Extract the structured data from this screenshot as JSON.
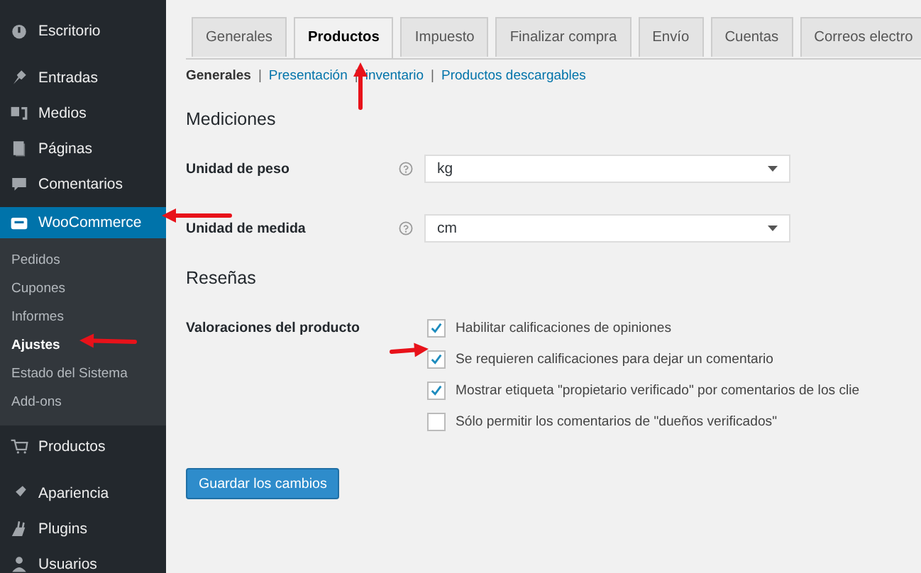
{
  "sidebar": {
    "items": [
      {
        "label": "Escritorio",
        "selected": false
      },
      {
        "label": "Entradas",
        "selected": false
      },
      {
        "label": "Medios",
        "selected": false
      },
      {
        "label": "Páginas",
        "selected": false
      },
      {
        "label": "Comentarios",
        "selected": false
      },
      {
        "label": "WooCommerce",
        "selected": true,
        "children": [
          {
            "label": "Pedidos",
            "selected": false
          },
          {
            "label": "Cupones",
            "selected": false
          },
          {
            "label": "Informes",
            "selected": false
          },
          {
            "label": "Ajustes",
            "selected": true
          },
          {
            "label": "Estado del Sistema",
            "selected": false
          },
          {
            "label": "Add-ons",
            "selected": false
          }
        ]
      },
      {
        "label": "Productos",
        "selected": false
      },
      {
        "label": "Apariencia",
        "selected": false
      },
      {
        "label": "Plugins",
        "selected": false
      },
      {
        "label": "Usuarios",
        "selected": false
      }
    ]
  },
  "tabs": [
    {
      "label": "Generales",
      "selected": false
    },
    {
      "label": "Productos",
      "selected": true
    },
    {
      "label": "Impuesto",
      "selected": false
    },
    {
      "label": "Finalizar compra",
      "selected": false
    },
    {
      "label": "Envío",
      "selected": false
    },
    {
      "label": "Cuentas",
      "selected": false
    },
    {
      "label": "Correos electro",
      "selected": false
    }
  ],
  "subnav": [
    {
      "kind": "link",
      "label": "Generales",
      "selected": true
    },
    {
      "kind": "separator",
      "label": "|"
    },
    {
      "kind": "link",
      "label": "Presentación",
      "selected": false
    },
    {
      "kind": "separator",
      "label": "|"
    },
    {
      "kind": "link",
      "label": "inventario",
      "selected": false
    },
    {
      "kind": "separator",
      "label": "|"
    },
    {
      "kind": "link",
      "label": "Productos descargables",
      "selected": false
    }
  ],
  "sections": [
    {
      "title": "Mediciones",
      "rows": [
        {
          "kind": "select",
          "label": "Unidad de peso",
          "value": "kg"
        },
        {
          "kind": "select",
          "label": "Unidad de medida",
          "value": "cm"
        }
      ]
    },
    {
      "title": "Reseñas",
      "rows": [
        {
          "kind": "checkboxes",
          "label": "Valoraciones del producto",
          "options": [
            {
              "label": "Habilitar calificaciones de opiniones",
              "checked": true
            },
            {
              "label": "Se requieren calificaciones para dejar un comentario",
              "checked": true
            },
            {
              "label": "Mostrar etiqueta \"propietario verificado\" por comentarios de los clie",
              "checked": true
            },
            {
              "label": "Sólo permitir los comentarios de \"dueños verificados\"",
              "checked": false
            }
          ]
        }
      ]
    }
  ],
  "save_button": "Guardar los cambios"
}
